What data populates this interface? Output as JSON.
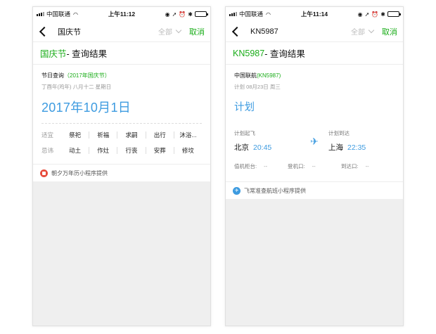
{
  "left": {
    "status": {
      "carrier": "中国联通",
      "time": "上午11:12"
    },
    "nav": {
      "title": "国庆节",
      "category": "全部",
      "cancel": "取消"
    },
    "heading": {
      "highlight": "国庆节",
      "rest": " - 查询结果"
    },
    "query": {
      "label": "节日查询",
      "tag": "（2017年国庆节）",
      "lunar": "丁酉年(鸡年) 八月十二 星期日",
      "date": "2017年10月1日"
    },
    "almanac": {
      "good_label": "适宜",
      "good": [
        "祭祀",
        "祈福",
        "求嗣",
        "出行",
        "沐浴..."
      ],
      "bad_label": "忌讳",
      "bad": [
        "动土",
        "作灶",
        "行丧",
        "安葬",
        "修坟"
      ]
    },
    "footer": "朝夕万年历小程序提供"
  },
  "right": {
    "status": {
      "carrier": "中国联通",
      "time": "上午11:14"
    },
    "nav": {
      "title": "KN5987",
      "category": "全部",
      "cancel": "取消"
    },
    "heading": {
      "highlight": "KN5987",
      "rest": " - 查询结果"
    },
    "flight": {
      "airline": "中国联航",
      "code": "(KN5987)",
      "plan_date": "计划 08月23日 周三",
      "status": "计划",
      "dep_label": "计划起飞",
      "dep_city": "北京",
      "dep_time": "20:45",
      "arr_label": "计划到达",
      "arr_city": "上海",
      "arr_time": "22:35",
      "checkin_label": "值机柜台:",
      "checkin_value": "--",
      "gate_label": "登机口:",
      "gate_value": "--",
      "arrival_label": "到达口:",
      "arrival_value": "--"
    },
    "footer": "飞常准查航班小程序提供"
  },
  "colors": {
    "accent_green": "#1aad19",
    "accent_blue": "#3d9be0"
  },
  "icons": {
    "back": "chevron-left-icon",
    "wifi": "wifi-icon",
    "plane": "airplane-icon",
    "calendar": "calendar-icon"
  }
}
